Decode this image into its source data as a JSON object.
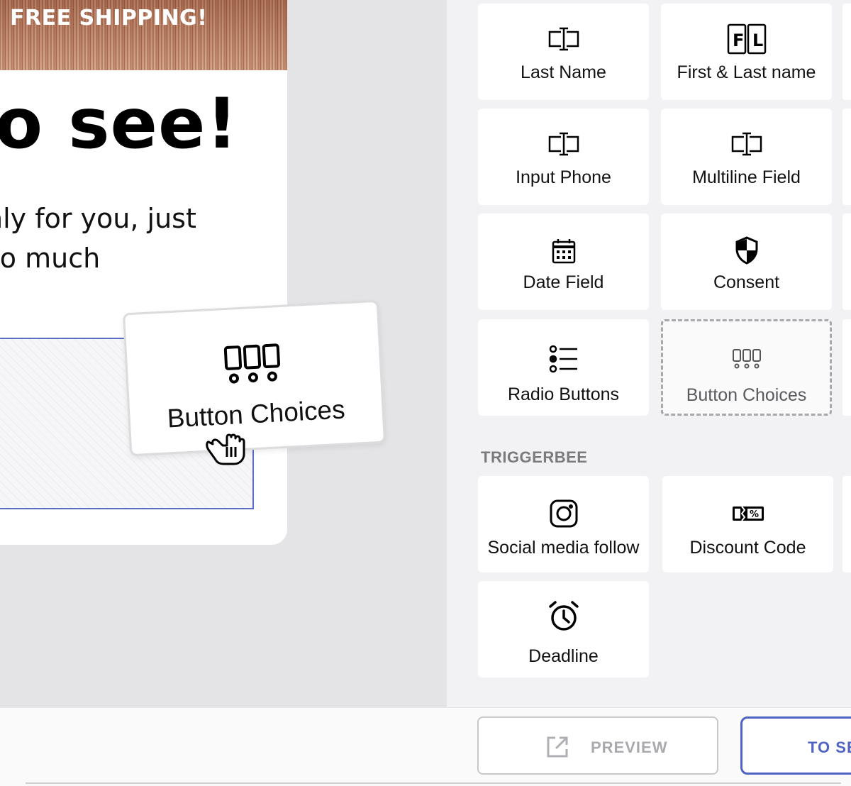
{
  "canvas": {
    "banner_text": "FREE SHIPPING!",
    "headline": "no see!",
    "body_line1": "nly for you, just",
    "body_line2": "so much"
  },
  "drag": {
    "label": "Button Choices",
    "icon": "button-choices-icon",
    "cursor": "grab-hand-icon"
  },
  "fields": [
    {
      "label": "Last Name",
      "icon": "text-cursor-icon"
    },
    {
      "label": "First & Last name",
      "icon": "first-last-icon"
    },
    {
      "label": "Input Phone",
      "icon": "text-cursor-icon"
    },
    {
      "label": "Multiline Field",
      "icon": "text-cursor-icon"
    },
    {
      "label": "Date Field",
      "icon": "calendar-icon"
    },
    {
      "label": "Consent",
      "icon": "shield-icon"
    },
    {
      "label": "Radio Buttons",
      "icon": "radio-list-icon"
    },
    {
      "label": "Button Choices",
      "icon": "button-choices-icon",
      "state": "placeholder"
    }
  ],
  "triggerbee": {
    "title": "TRIGGERBEE",
    "items": [
      {
        "label": "Social media follow",
        "icon": "instagram-icon"
      },
      {
        "label": "Discount Code",
        "icon": "discount-ticket-icon"
      },
      {
        "label": "Deadline",
        "icon": "alarm-clock-icon"
      }
    ]
  },
  "footer": {
    "preview_label": "PREVIEW",
    "next_label": "TO SE"
  },
  "colors": {
    "accent": "#4f63c4",
    "panel_bg": "#f2f2f4",
    "canvas_bg": "#e4e4e6"
  }
}
